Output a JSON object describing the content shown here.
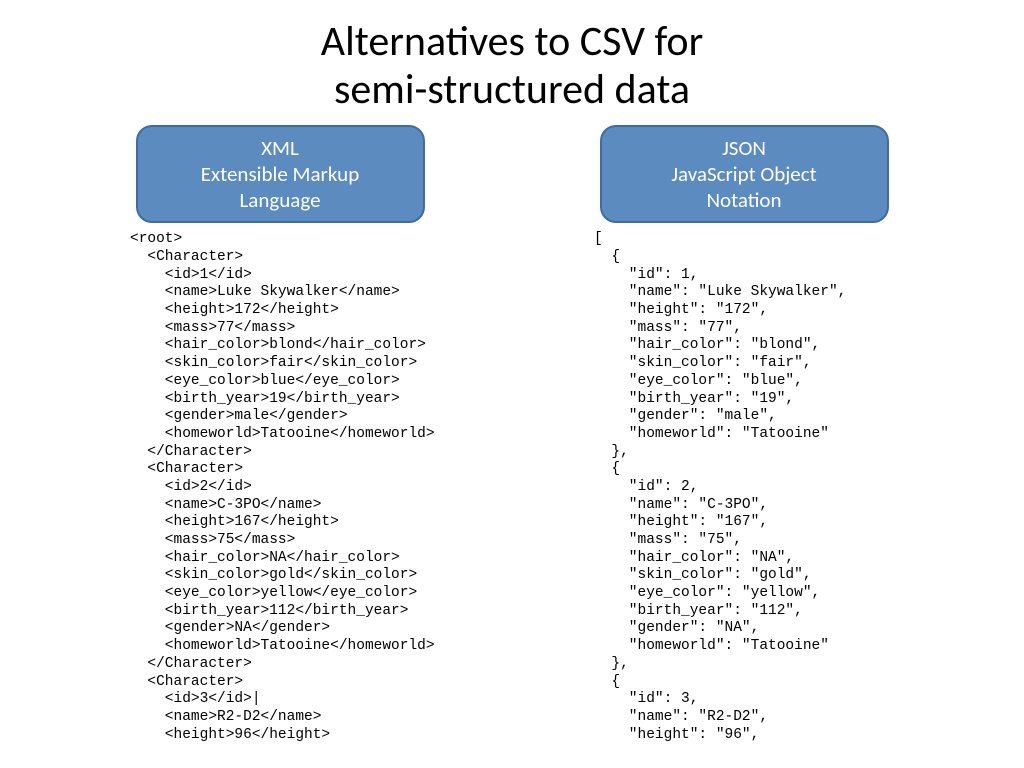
{
  "title_line1": "Alternatives to CSV for",
  "title_line2": "semi-structured data",
  "left": {
    "heading_line1": "XML",
    "heading_line2": "Extensible Markup",
    "heading_line3": "Language",
    "code": "<root>\n  <Character>\n    <id>1</id>\n    <name>Luke Skywalker</name>\n    <height>172</height>\n    <mass>77</mass>\n    <hair_color>blond</hair_color>\n    <skin_color>fair</skin_color>\n    <eye_color>blue</eye_color>\n    <birth_year>19</birth_year>\n    <gender>male</gender>\n    <homeworld>Tatooine</homeworld>\n  </Character>\n  <Character>\n    <id>2</id>\n    <name>C-3PO</name>\n    <height>167</height>\n    <mass>75</mass>\n    <hair_color>NA</hair_color>\n    <skin_color>gold</skin_color>\n    <eye_color>yellow</eye_color>\n    <birth_year>112</birth_year>\n    <gender>NA</gender>\n    <homeworld>Tatooine</homeworld>\n  </Character>\n  <Character>\n    <id>3</id>|\n    <name>R2-D2</name>\n    <height>96</height>"
  },
  "right": {
    "heading_line1": "JSON",
    "heading_line2": "JavaScript Object",
    "heading_line3": "Notation",
    "code": "[\n  {\n    \"id\": 1,\n    \"name\": \"Luke Skywalker\",\n    \"height\": \"172\",\n    \"mass\": \"77\",\n    \"hair_color\": \"blond\",\n    \"skin_color\": \"fair\",\n    \"eye_color\": \"blue\",\n    \"birth_year\": \"19\",\n    \"gender\": \"male\",\n    \"homeworld\": \"Tatooine\"\n  },\n  {\n    \"id\": 2,\n    \"name\": \"C-3PO\",\n    \"height\": \"167\",\n    \"mass\": \"75\",\n    \"hair_color\": \"NA\",\n    \"skin_color\": \"gold\",\n    \"eye_color\": \"yellow\",\n    \"birth_year\": \"112\",\n    \"gender\": \"NA\",\n    \"homeworld\": \"Tatooine\"\n  },\n  {\n    \"id\": 3,\n    \"name\": \"R2-D2\",\n    \"height\": \"96\","
  }
}
